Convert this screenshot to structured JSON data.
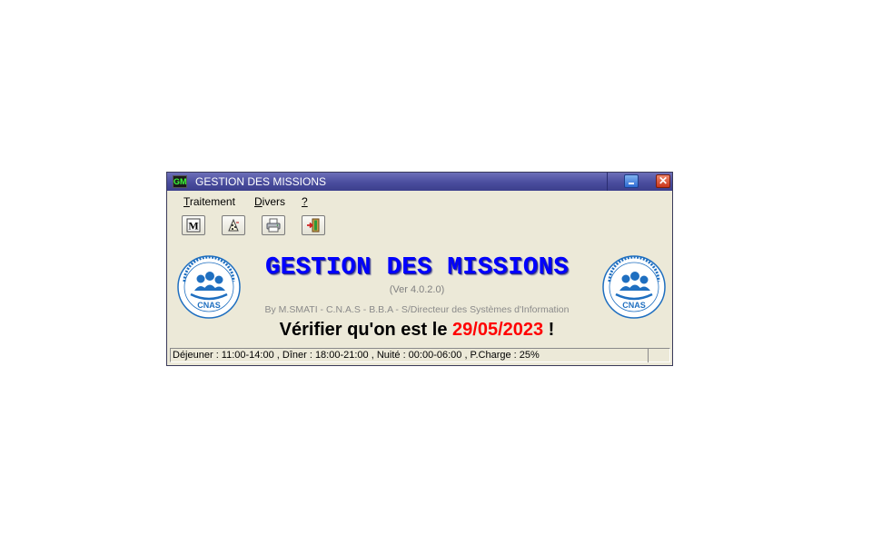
{
  "window": {
    "title": "GESTION DES MISSIONS",
    "icon_text": "GM"
  },
  "menu": {
    "items": [
      {
        "accel": "T",
        "rest": "raitement"
      },
      {
        "accel": "D",
        "rest": "ivers"
      },
      {
        "accel": "?",
        "rest": ""
      }
    ]
  },
  "toolbar": {
    "buttons": [
      {
        "icon": "missions-icon",
        "glyph": "M"
      },
      {
        "icon": "calculator-icon"
      },
      {
        "icon": "printer-icon"
      },
      {
        "icon": "exit-door-icon"
      }
    ]
  },
  "header": {
    "title": "GESTION DES MISSIONS",
    "version": "(Ver 4.0.2.0)",
    "byline": "By M.SMATI - C.N.A.S - B.B.A - S/Directeur des Systèmes d'Information",
    "logo_text": "CNAS"
  },
  "notice": {
    "prefix": "Vérifier qu'on est le ",
    "date": "29/05/2023",
    "suffix": " !"
  },
  "status": {
    "text": "Déjeuner : 11:00-14:00 , Dîner : 18:00-21:00 , Nuité : 00:00-06:00 , P.Charge : 25%"
  },
  "colors": {
    "title_blue": "#0000ff",
    "date_red": "#ff0000",
    "titlebar": "#4a4d9e",
    "window_bg": "#ece9d8",
    "logo_blue": "#1f6fc0"
  }
}
